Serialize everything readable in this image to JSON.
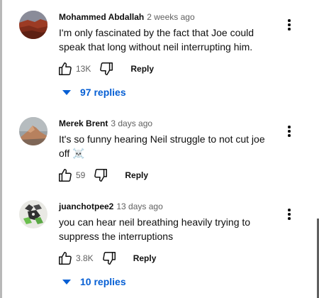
{
  "comments": [
    {
      "author": "Mohammed Abdallah",
      "time": "2 weeks ago",
      "text": "I'm only fascinated by the fact that Joe could speak that long without neil interrupting him.",
      "likes": "13K",
      "reply_label": "Reply",
      "replies_label": "97 replies",
      "avatar": "red-desert-landscape"
    },
    {
      "author": "Merek Brent",
      "time": "3 days ago",
      "text": "It's so funny hearing Neil struggle to not cut joe off ☠️",
      "likes": "59",
      "reply_label": "Reply",
      "avatar": "mountain-landscape"
    },
    {
      "author": "juanchotpee2",
      "time": "13 days ago",
      "text": "you can hear neil breathing heavily trying to suppress the interruptions",
      "likes": "3.8K",
      "reply_label": "Reply",
      "replies_label": "10 replies",
      "avatar": "character-sketch"
    }
  ],
  "icons": {
    "like": "thumb-up-icon",
    "dislike": "thumb-down-icon",
    "menu": "more-vert-icon",
    "expand": "caret-down-icon"
  },
  "colors": {
    "link": "#065fd4",
    "text": "#0f0f0f",
    "secondary": "#606060"
  }
}
